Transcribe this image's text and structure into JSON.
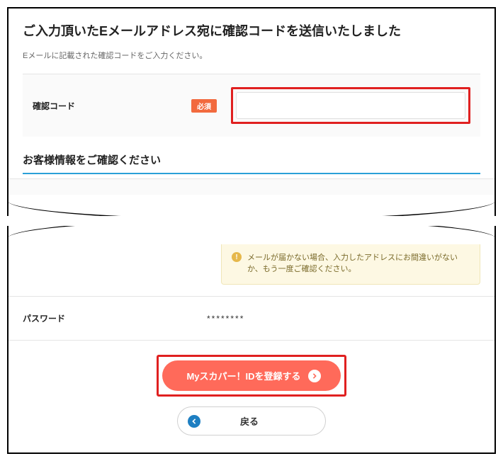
{
  "heading": "ご入力頂いたEメールアドレス宛に確認コードを送信いたしました",
  "instruction": "Eメールに記載された確認コードをご入力ください。",
  "confirm_code": {
    "label": "確認コード",
    "required_badge": "必須",
    "value": ""
  },
  "section2_heading": "お客様情報をご確認ください",
  "notice": "メールが届かない場合、入力したアドレスにお間違いがないか、もう一度ご確認ください。",
  "password": {
    "label": "パスワード",
    "masked": "********"
  },
  "buttons": {
    "register": "Myスカパー！IDを登録する",
    "back": "戻る"
  }
}
